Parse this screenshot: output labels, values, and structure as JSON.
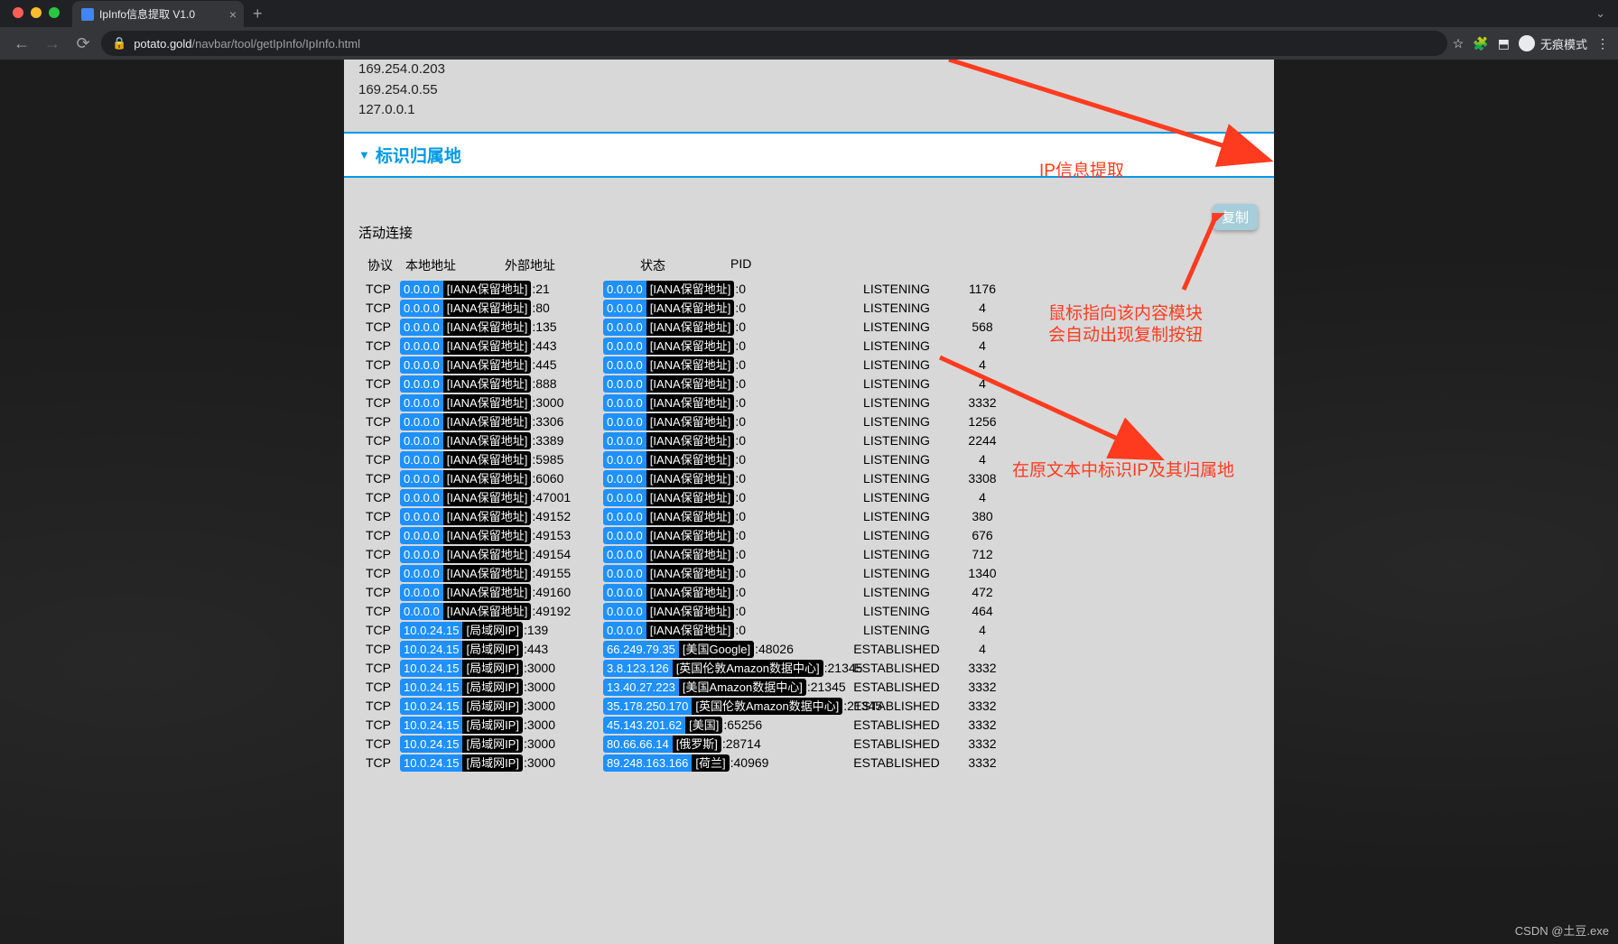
{
  "browser": {
    "tab_title": "IpInfo信息提取 V1.0",
    "url_host": "potato.gold",
    "url_path": "/navbar/tool/getIpInfo/IpInfo.html",
    "incognito_label": "无痕模式"
  },
  "page": {
    "top_ips": [
      "169.254.0.203",
      "169.254.0.55",
      "127.0.0.1"
    ],
    "accordion_title": "标识归属地",
    "copy_button": "复制",
    "content_title": "活动连接",
    "headers": {
      "proto": "协议",
      "local": "本地地址",
      "ext": "外部地址",
      "state": "状态",
      "pid": "PID"
    }
  },
  "annotations": {
    "a1": "IP信息提取",
    "a2_l1": "鼠标指向该内容模块",
    "a2_l2": "会自动出现复制按钮",
    "a3": "在原文本中标识IP及其归属地"
  },
  "rows": [
    {
      "p": "TCP",
      "li": "0.0.0.0",
      "ll": "[IANA保留地址]",
      "lp": ":21",
      "ei": "0.0.0.0",
      "el": "[IANA保留地址]",
      "ep": ":0",
      "s": "LISTENING",
      "pid": "1176"
    },
    {
      "p": "TCP",
      "li": "0.0.0.0",
      "ll": "[IANA保留地址]",
      "lp": ":80",
      "ei": "0.0.0.0",
      "el": "[IANA保留地址]",
      "ep": ":0",
      "s": "LISTENING",
      "pid": "4"
    },
    {
      "p": "TCP",
      "li": "0.0.0.0",
      "ll": "[IANA保留地址]",
      "lp": ":135",
      "ei": "0.0.0.0",
      "el": "[IANA保留地址]",
      "ep": ":0",
      "s": "LISTENING",
      "pid": "568"
    },
    {
      "p": "TCP",
      "li": "0.0.0.0",
      "ll": "[IANA保留地址]",
      "lp": ":443",
      "ei": "0.0.0.0",
      "el": "[IANA保留地址]",
      "ep": ":0",
      "s": "LISTENING",
      "pid": "4"
    },
    {
      "p": "TCP",
      "li": "0.0.0.0",
      "ll": "[IANA保留地址]",
      "lp": ":445",
      "ei": "0.0.0.0",
      "el": "[IANA保留地址]",
      "ep": ":0",
      "s": "LISTENING",
      "pid": "4"
    },
    {
      "p": "TCP",
      "li": "0.0.0.0",
      "ll": "[IANA保留地址]",
      "lp": ":888",
      "ei": "0.0.0.0",
      "el": "[IANA保留地址]",
      "ep": ":0",
      "s": "LISTENING",
      "pid": "4"
    },
    {
      "p": "TCP",
      "li": "0.0.0.0",
      "ll": "[IANA保留地址]",
      "lp": ":3000",
      "ei": "0.0.0.0",
      "el": "[IANA保留地址]",
      "ep": ":0",
      "s": "LISTENING",
      "pid": "3332"
    },
    {
      "p": "TCP",
      "li": "0.0.0.0",
      "ll": "[IANA保留地址]",
      "lp": ":3306",
      "ei": "0.0.0.0",
      "el": "[IANA保留地址]",
      "ep": ":0",
      "s": "LISTENING",
      "pid": "1256"
    },
    {
      "p": "TCP",
      "li": "0.0.0.0",
      "ll": "[IANA保留地址]",
      "lp": ":3389",
      "ei": "0.0.0.0",
      "el": "[IANA保留地址]",
      "ep": ":0",
      "s": "LISTENING",
      "pid": "2244"
    },
    {
      "p": "TCP",
      "li": "0.0.0.0",
      "ll": "[IANA保留地址]",
      "lp": ":5985",
      "ei": "0.0.0.0",
      "el": "[IANA保留地址]",
      "ep": ":0",
      "s": "LISTENING",
      "pid": "4"
    },
    {
      "p": "TCP",
      "li": "0.0.0.0",
      "ll": "[IANA保留地址]",
      "lp": ":6060",
      "ei": "0.0.0.0",
      "el": "[IANA保留地址]",
      "ep": ":0",
      "s": "LISTENING",
      "pid": "3308"
    },
    {
      "p": "TCP",
      "li": "0.0.0.0",
      "ll": "[IANA保留地址]",
      "lp": ":47001",
      "ei": "0.0.0.0",
      "el": "[IANA保留地址]",
      "ep": ":0",
      "s": "LISTENING",
      "pid": "4"
    },
    {
      "p": "TCP",
      "li": "0.0.0.0",
      "ll": "[IANA保留地址]",
      "lp": ":49152",
      "ei": "0.0.0.0",
      "el": "[IANA保留地址]",
      "ep": ":0",
      "s": "LISTENING",
      "pid": "380"
    },
    {
      "p": "TCP",
      "li": "0.0.0.0",
      "ll": "[IANA保留地址]",
      "lp": ":49153",
      "ei": "0.0.0.0",
      "el": "[IANA保留地址]",
      "ep": ":0",
      "s": "LISTENING",
      "pid": "676"
    },
    {
      "p": "TCP",
      "li": "0.0.0.0",
      "ll": "[IANA保留地址]",
      "lp": ":49154",
      "ei": "0.0.0.0",
      "el": "[IANA保留地址]",
      "ep": ":0",
      "s": "LISTENING",
      "pid": "712"
    },
    {
      "p": "TCP",
      "li": "0.0.0.0",
      "ll": "[IANA保留地址]",
      "lp": ":49155",
      "ei": "0.0.0.0",
      "el": "[IANA保留地址]",
      "ep": ":0",
      "s": "LISTENING",
      "pid": "1340"
    },
    {
      "p": "TCP",
      "li": "0.0.0.0",
      "ll": "[IANA保留地址]",
      "lp": ":49160",
      "ei": "0.0.0.0",
      "el": "[IANA保留地址]",
      "ep": ":0",
      "s": "LISTENING",
      "pid": "472"
    },
    {
      "p": "TCP",
      "li": "0.0.0.0",
      "ll": "[IANA保留地址]",
      "lp": ":49192",
      "ei": "0.0.0.0",
      "el": "[IANA保留地址]",
      "ep": ":0",
      "s": "LISTENING",
      "pid": "464"
    },
    {
      "p": "TCP",
      "li": "10.0.24.15",
      "ll": "[局域网IP]",
      "lp": ":139",
      "ei": "0.0.0.0",
      "el": "[IANA保留地址]",
      "ep": ":0",
      "s": "LISTENING",
      "pid": "4"
    },
    {
      "p": "TCP",
      "li": "10.0.24.15",
      "ll": "[局域网IP]",
      "lp": ":443",
      "ei": "66.249.79.35",
      "el": "[美国Google]",
      "ep": ":48026",
      "s": "ESTABLISHED",
      "pid": "4"
    },
    {
      "p": "TCP",
      "li": "10.0.24.15",
      "ll": "[局域网IP]",
      "lp": ":3000",
      "ei": "3.8.123.126",
      "el": "[英国伦敦Amazon数据中心]",
      "ep": ":21345",
      "s": "ESTABLISHED",
      "pid": "3332"
    },
    {
      "p": "TCP",
      "li": "10.0.24.15",
      "ll": "[局域网IP]",
      "lp": ":3000",
      "ei": "13.40.27.223",
      "el": "[美国Amazon数据中心]",
      "ep": ":21345",
      "s": "ESTABLISHED",
      "pid": "3332"
    },
    {
      "p": "TCP",
      "li": "10.0.24.15",
      "ll": "[局域网IP]",
      "lp": ":3000",
      "ei": "35.178.250.170",
      "el": "[英国伦敦Amazon数据中心]",
      "ep": ":21345",
      "s": "ESTABLISHED",
      "pid": "3332"
    },
    {
      "p": "TCP",
      "li": "10.0.24.15",
      "ll": "[局域网IP]",
      "lp": ":3000",
      "ei": "45.143.201.62",
      "el": "[美国]",
      "ep": ":65256",
      "s": "ESTABLISHED",
      "pid": "3332"
    },
    {
      "p": "TCP",
      "li": "10.0.24.15",
      "ll": "[局域网IP]",
      "lp": ":3000",
      "ei": "80.66.66.14",
      "el": "[俄罗斯]",
      "ep": ":28714",
      "s": "ESTABLISHED",
      "pid": "3332"
    },
    {
      "p": "TCP",
      "li": "10.0.24.15",
      "ll": "[局域网IP]",
      "lp": ":3000",
      "ei": "89.248.163.166",
      "el": "[荷兰]",
      "ep": ":40969",
      "s": "ESTABLISHED",
      "pid": "3332"
    }
  ],
  "watermark": "CSDN @土豆.exe"
}
